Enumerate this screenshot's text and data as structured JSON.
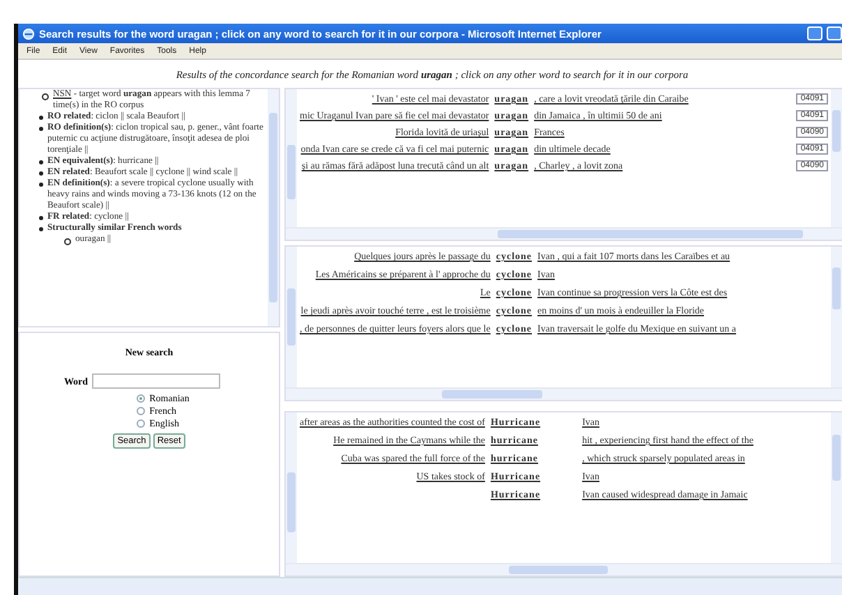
{
  "window": {
    "title": "Search results for the word uragan ; click on any word to search for it in our corpora - Microsoft Internet Explorer"
  },
  "menu": [
    "File",
    "Edit",
    "View",
    "Favorites",
    "Tools",
    "Help"
  ],
  "heading": "Results of the concordance search for the Romanian word **uragan** ; click on any other word to search for it in our corpora",
  "info": {
    "lemma": {
      "link": "NSN",
      "text": "- target word **uragan** appears with this lemma 7 time(s) in the RO corpus"
    },
    "items": [
      {
        "text": "**RO related**: ciclon || scala Beaufort ||"
      },
      {
        "text": "**RO definition(s)**: ciclon tropical sau, p. gener., vânt foarte puternic cu acţiune distrugătoare, însoţit adesea de ploi torenţiale ||"
      },
      {
        "text": "**EN equivalent(s)**: hurricane ||"
      },
      {
        "text": "**EN related**: Beaufort scale || cyclone || wind scale ||"
      },
      {
        "text": "**EN definition(s)**: a severe tropical cyclone usually with heavy rains and winds moving a 73-136 knots (12 on the Beaufort scale) ||"
      },
      {
        "text": "**FR related**: cyclone ||"
      },
      {
        "text": "**Structurally similar French words**",
        "children": [
          {
            "text": "ouragan ||"
          }
        ]
      }
    ]
  },
  "search": {
    "title": "New search",
    "word_label": "Word",
    "languages": [
      {
        "label": "Romanian",
        "selected": true
      },
      {
        "label": "French",
        "selected": false
      },
      {
        "label": "English",
        "selected": false
      }
    ],
    "buttons": [
      "Search",
      "Reset"
    ]
  },
  "panels": [
    {
      "rows": [
        {
          "left": "' Ivan ' este cel mai devastator",
          "keyword": "uragan",
          "right": ", care a lovit vreodată ţările din Caraibe",
          "id": "04091"
        },
        {
          "left": "mic Uraganul Ivan pare să fie cel mai devastator",
          "keyword": "uragan",
          "right": "din Jamaica , în ultimii 50 de ani",
          "id": "04091"
        },
        {
          "left": "Florida lovită de uriaşul",
          "keyword": "uragan",
          "right": "Frances",
          "id": "04090"
        },
        {
          "left": "onda Ivan care se crede că va fi cel mai puternic",
          "keyword": "uragan",
          "right": "din ultimele decade",
          "id": "04091"
        },
        {
          "left": "şi au rămas fără adăpost luna trecută când un alt",
          "keyword": "uragan",
          "right": ", Charley , a lovit zona",
          "id": "04090"
        }
      ]
    },
    {
      "rows": [
        {
          "left": "Quelques jours après le passage du",
          "keyword": "cyclone",
          "right": "Ivan , qui a fait 107 morts dans les Caraïbes et au"
        },
        {
          "left": "Les Américains se préparent à l' approche du",
          "keyword": "cyclone",
          "right": "Ivan"
        },
        {
          "left": "Le",
          "keyword": "cyclone",
          "right": "Ivan continue sa progression vers la Côte est des"
        },
        {
          "left": "le jeudi après avoir touché terre , est le troisième",
          "keyword": "cyclone",
          "right": "en moins d' un mois à endeuiller la Floride"
        },
        {
          "left": ", de personnes de quitter leurs foyers alors que le",
          "keyword": "cyclone",
          "right": "Ivan traversait le golfe du Mexique en suivant un a"
        }
      ]
    },
    {
      "rows": [
        {
          "left": "after areas as the authorities counted the cost of",
          "keyword": "Hurricane",
          "right": "Ivan"
        },
        {
          "left": "He remained in the Caymans while the",
          "keyword": "hurricane",
          "right": "hit , experiencing first hand the effect of the"
        },
        {
          "left": "Cuba was spared the full force of the",
          "keyword": "hurricane",
          "right": ", which struck sparsely populated areas in"
        },
        {
          "left": "US takes stock of",
          "keyword": "Hurricane",
          "right": "Ivan"
        },
        {
          "keyword": "Hurricane",
          "right": "Ivan caused widespread damage in Jamaic"
        }
      ]
    }
  ]
}
